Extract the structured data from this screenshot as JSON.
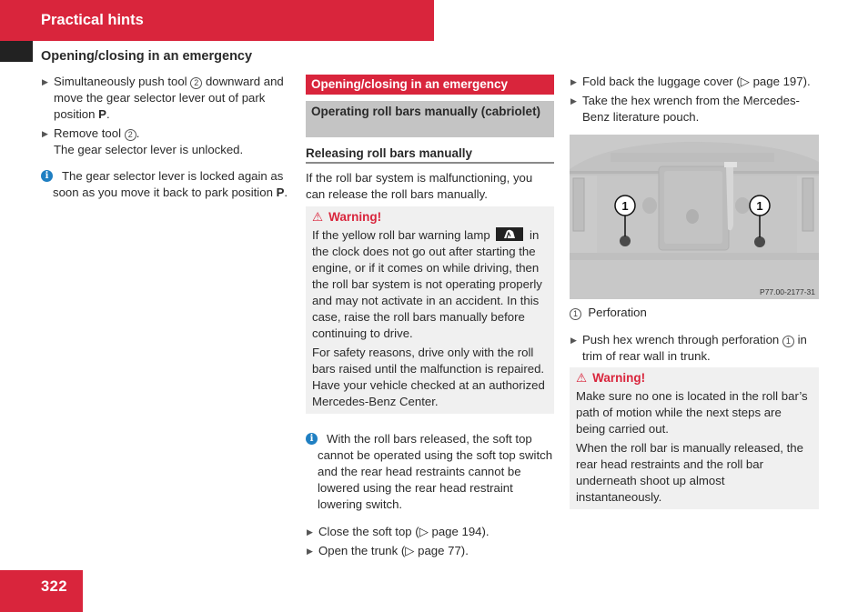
{
  "header": {
    "title": "Practical hints",
    "section": "Opening/closing in an emergency"
  },
  "colors": {
    "brand_red": "#d9253c",
    "info_blue": "#1f7fc2",
    "gray_bar": "#c4c4c4",
    "warning_bg": "#f0f0f0"
  },
  "col1": {
    "step1": {
      "pre": "Simultaneously push tool",
      "ref": "2",
      "post": "downward and move the gear selector lever out of park position",
      "bold": "P",
      "end": "."
    },
    "step2": {
      "pre": "Remove tool",
      "ref": "2",
      "end": ".",
      "result": "The gear selector lever is unlocked."
    },
    "info": {
      "icon": "info-icon",
      "text": "The gear selector lever is locked again as soon as you move it back to park position",
      "bold": "P",
      "end": "."
    }
  },
  "col2": {
    "red_heading": "Opening/closing in an emergency",
    "gray_heading": "Operating roll bars manually (cabriolet)",
    "subheading": "Releasing roll bars manually",
    "intro": "If the roll bar system is malfunctioning, you can release the roll bars manually.",
    "warning": {
      "title": "Warning!",
      "p1_pre": "If the yellow roll bar warning lamp",
      "p1_post": "in the clock does not go out after starting the engine, or if it comes on while driving, then the roll bar system is not operating properly and may not activate in an accident. In this case, raise the roll bars manually before continuing to drive.",
      "p2": "For safety reasons, drive only with the roll bars raised until the malfunction is repaired. Have your vehicle checked at an authorized Mercedes-Benz Center."
    },
    "info": "With the roll bars released, the soft top cannot be operated using the soft top switch and the rear head restraints cannot be lowered using the rear head restraint lowering switch.",
    "step1": {
      "pre": "Close the soft top (",
      "ref_symbol": "▷",
      "page": " page 194",
      "end": ")."
    },
    "step2": {
      "pre": "Open the trunk (",
      "ref_symbol": "▷",
      "page": " page 77",
      "end": ")."
    }
  },
  "col3": {
    "step1": {
      "pre": "Fold back the luggage cover (",
      "ref_symbol": "▷",
      "page": " page 197",
      "end": ")."
    },
    "step2": "Take the hex wrench from the Mercedes-Benz literature pouch.",
    "figure": {
      "code": "P77.00-2177-31",
      "callout_left": "1",
      "callout_right": "1"
    },
    "caption": {
      "ref": "1",
      "text": "Perforation"
    },
    "step3": {
      "pre": "Push hex wrench through perforation",
      "ref": "1",
      "post": "in trim of rear wall in trunk."
    },
    "warning": {
      "title": "Warning!",
      "p1": "Make sure no one is located in the roll bar’s path of motion while the next steps are being carried out.",
      "p2": "When the roll bar is manually released, the rear head restraints and the roll bar underneath shoot up almost instantaneously."
    }
  },
  "footer": {
    "page_number": "322"
  }
}
